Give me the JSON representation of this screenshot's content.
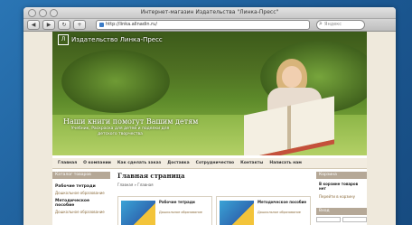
{
  "window": {
    "title": "Интернет-магазин Издательства \"Линка-Пресс\"",
    "url": "http://linka.allnadin.ru/",
    "search_placeholder": "Яндекс"
  },
  "site": {
    "logo_text": "Издательство Линка-Пресс",
    "slogan": "Наши книги помогут Вашим детям",
    "slogan_sub": "Учебник, Раскраска для детей и поделки для детского творчества",
    "nav": [
      "Главная",
      "О компании",
      "Как сделать заказ",
      "Доставка",
      "Сотрудничество",
      "Контакты",
      "Написать нам"
    ],
    "left": {
      "header": "Каталог товаров",
      "items": [
        {
          "title": "Рабочие тетради",
          "sub": "Дошкольное образование"
        },
        {
          "title": "Методическое пособие",
          "sub": "Дошкольное образование"
        }
      ]
    },
    "main": {
      "title": "Главная страница",
      "breadcrumb": "Главная » Главная",
      "tiles": [
        {
          "title": "Рабочие тетради",
          "link": "Дошкольное образование"
        },
        {
          "title": "Методическое пособие",
          "link": "Дошкольное образование"
        }
      ]
    },
    "right": {
      "header": "Корзина",
      "title": "В корзине товаров нет",
      "link": "Перейти в корзину",
      "login_header": "Вход"
    }
  }
}
